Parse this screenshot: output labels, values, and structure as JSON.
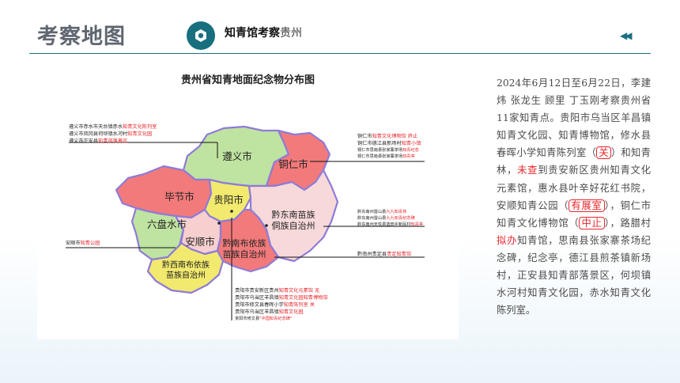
{
  "header": {
    "title": "考察地图",
    "subtitle_bold": "知青馆考察",
    "subtitle_rest": "贵州",
    "back_glyph": "◀◀"
  },
  "map": {
    "title": "贵州省知青地面纪念物分布图",
    "regions": [
      {
        "name": "遵义市",
        "color": "#bfe3a0"
      },
      {
        "name": "铜仁市",
        "color": "#f27a7a"
      },
      {
        "name": "毕节市",
        "color": "#f27a7a"
      },
      {
        "name": "贵阳市",
        "color": "#f2ea6e"
      },
      {
        "name": "六盘水市",
        "color": "#bfe3a0"
      },
      {
        "name": "安顺市",
        "color": "#f7cfcf"
      },
      {
        "name": "黔东南苗族侗族自治州",
        "label_line1": "黔东南苗族",
        "label_line2": "侗族自治州",
        "color": "#f7d9d9"
      },
      {
        "name": "黔南布依族苗族自治州",
        "label_line1": "黔南布依族",
        "label_line2": "苗族自治州",
        "color": "#f27a7a"
      },
      {
        "name": "黔西南布依族苗族自治州",
        "label_line1": "黔西南布依族",
        "label_line2": "苗族自治州",
        "color": "#f2ea6e"
      }
    ],
    "callouts": {
      "zunyi": [
        {
          "prefix": "遵义市赤水市天台镇赤水",
          "highlight": "知青文化陈列室"
        },
        {
          "prefix": "遵义市凤冈县何坝镇水河村",
          "highlight": "知青文化园"
        },
        {
          "prefix": "遵义市正安县",
          "highlight": "知青部落景区"
        }
      ],
      "tongren": [
        {
          "prefix": "铜仁市",
          "highlight": "知青文化博物馆",
          "suffix": "  终止"
        },
        {
          "prefix": "铜仁市德江县新场村",
          "highlight": "知青小镇"
        },
        {
          "prefix": "铜仁市思南县张家寨茶场",
          "highlight": "知青纪念"
        },
        {
          "prefix": "铜仁市思南县张家寨茶场",
          "highlight": "知青亭"
        }
      ],
      "qiandongnan": [
        {
          "prefix": "黔东南州雷山县",
          "highlight": "九九知青林"
        },
        {
          "prefix": "黔东南州雷山县",
          "highlight": "九九知青纪念碑"
        },
        {
          "prefix": "黔东南州天柱县蓝田乡新民村",
          "highlight": "知青亭"
        }
      ],
      "qiannan": [
        {
          "prefix": "黔南州贵定县",
          "highlight": "贵定知青馆"
        }
      ],
      "anshun": [
        {
          "prefix": "安顺市",
          "highlight": "知青公园"
        }
      ],
      "guiyang": [
        {
          "prefix": "贵阳市贵安新区贵州",
          "highlight": "知青文化元素馆",
          "suffix": "  无"
        },
        {
          "prefix": "贵阳市乌当区羊昌镇",
          "highlight": "知青文化园知青博物馆"
        },
        {
          "prefix": "贵阳市修文县春晖小学",
          "highlight": "知青陈列室",
          "suffix": " 关"
        },
        {
          "prefix": "贵阳市乌当区羊昌镇",
          "highlight": "知青文化园"
        },
        {
          "prefix": "贵阳市修文县",
          "highlight": "\"中国知青纪念碑\""
        }
      ]
    }
  },
  "description": {
    "p1": "2024年6月12日至6月22日，李建炜 张龙生 顾里 丁玉刚考察贵州省11家知青点。贵阳市乌当区羊昌镇知青文化园、知青博物馆，修水县春晖小学知青陈列室（",
    "mark1": "关",
    "p2": "）和知青林，",
    "mark2": "未查",
    "p3": "到贵安新区贵州知青文化元素馆，惠水县叶辛好花红书院，安顺知青公园（",
    "mark3": "有展室",
    "p4": "），铜仁市知青文化博物馆（",
    "mark4": "中止",
    "p5": "），路腊村",
    "mark5": "拟办",
    "p6": "知青馆，思南县张家寨茶场纪念碑，纪念亭，德江县煎茶镇新场村，正安县知青部落景区，何坝镇水河村知青文化园，赤水知青文化陈列室。"
  }
}
